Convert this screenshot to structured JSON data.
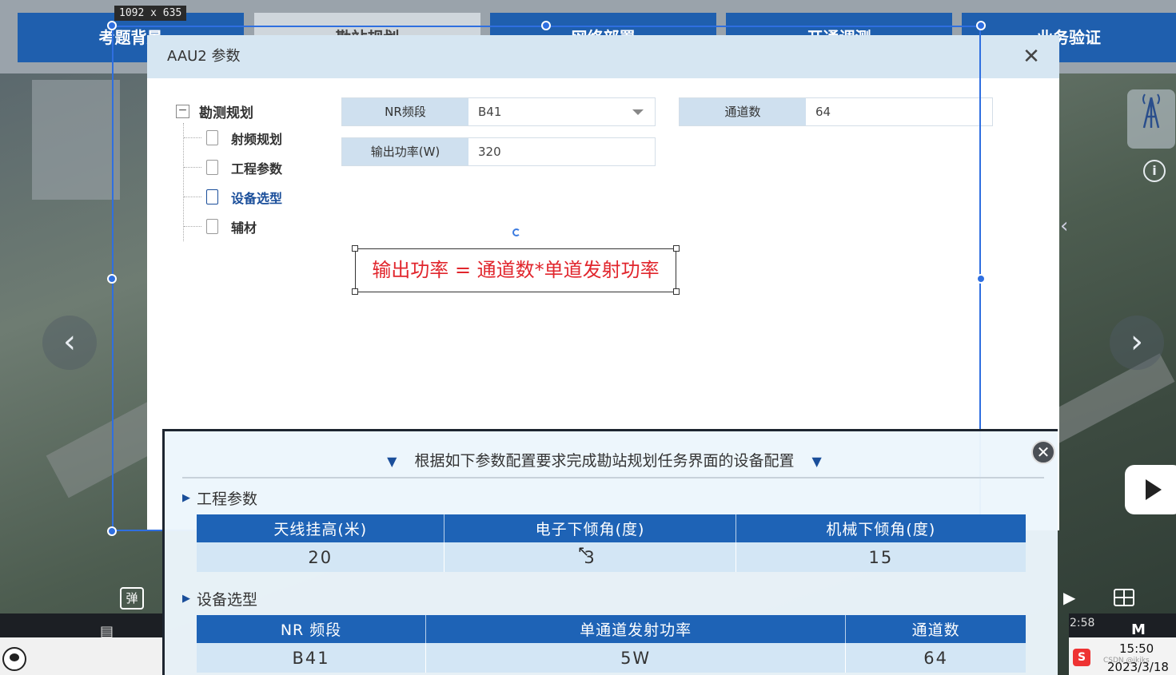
{
  "selection": {
    "dimensions_label": "1092 x 635"
  },
  "top_tabs": [
    {
      "label": "考题背景"
    },
    {
      "label": "勘站规划"
    },
    {
      "label": "网络部署"
    },
    {
      "label": "开通调测"
    },
    {
      "label": "业务验证"
    }
  ],
  "dialog": {
    "title": "AAU2 参数",
    "close_glyph": "✕",
    "tree": {
      "root_label": "勘测规划",
      "toggle_glyph": "−",
      "items": [
        {
          "label": "射频规划",
          "active": false
        },
        {
          "label": "工程参数",
          "active": false
        },
        {
          "label": "设备选型",
          "active": true
        },
        {
          "label": "辅材",
          "active": false
        }
      ]
    },
    "fields": {
      "nr_band": {
        "label": "NR频段",
        "value": "B41"
      },
      "channels": {
        "label": "通道数",
        "value": "64"
      },
      "output_power": {
        "label": "输出功率(W)",
        "value": "320"
      }
    },
    "annotation": "输出功率 = 通道数*单道发射功率"
  },
  "task_panel": {
    "title": "根据如下参数配置要求完成勘站规划任务界面的设备配置",
    "tri_glyph": "▼",
    "close_glyph": "✕",
    "section_glyph": "▶",
    "sections": [
      {
        "title": "工程参数",
        "headers": [
          "天线挂高(米)",
          "电子下倾角(度)",
          "机械下倾角(度)"
        ],
        "values": [
          "20",
          "3",
          "15"
        ]
      },
      {
        "title": "设备选型",
        "headers": [
          "NR 频段",
          "单通道发射功率",
          "通道数"
        ],
        "values": [
          "B41",
          "5W",
          "64"
        ]
      }
    ]
  },
  "player": {
    "danmu_label": "弹",
    "time_small": "2:58",
    "tray_time": "15:50",
    "tray_date": "2023/3/18",
    "watermark": "CSDN @jkiks"
  },
  "icons": [
    "tower-icon",
    "info-icon",
    "prev-arrow-icon",
    "next-arrow-icon",
    "play-icon",
    "fullscreen-icon"
  ]
}
